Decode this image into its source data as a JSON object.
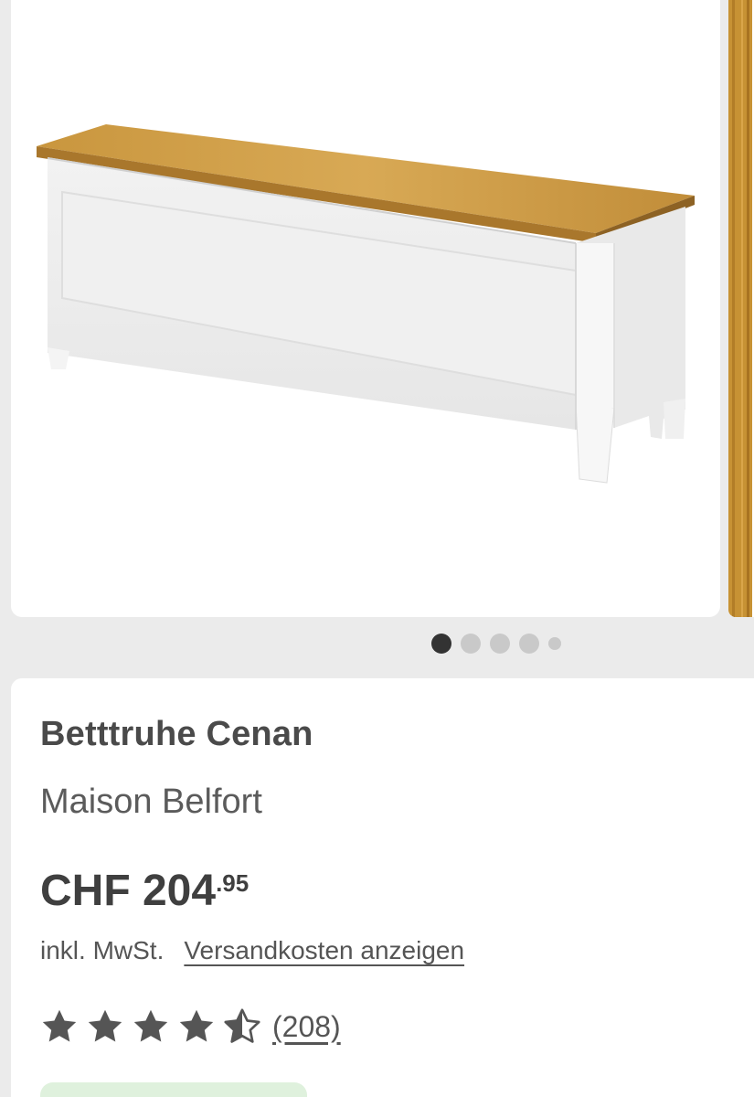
{
  "gallery": {
    "slide_count": 5,
    "active_index": 0
  },
  "product": {
    "title": "Betttruhe Cenan",
    "brand": "Maison Belfort",
    "price_main": "CHF 204",
    "price_cents": ".95",
    "tax_note": "inkl. MwSt.",
    "shipping_link": "Versandkosten anzeigen",
    "rating": 4.5,
    "review_count": "(208)"
  },
  "colors": {
    "background": "#ebebeb",
    "card": "#ffffff",
    "text": "#4a4a4a",
    "dot_active": "#333333",
    "dot_inactive": "#c9c9c9",
    "star": "#555555",
    "button_green": "#dff1dd"
  },
  "icons": {
    "star_full": "star-icon",
    "star_half": "star-half-icon"
  }
}
